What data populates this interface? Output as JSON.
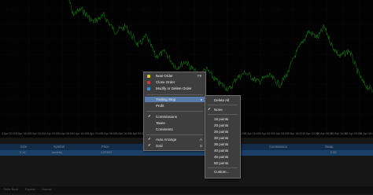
{
  "chart": {
    "x_labels": [
      "3 Apr 00:00",
      "3 Apr 08:00",
      "3 Apr 16:00",
      "4 Apr 00:00",
      "4 Apr 08:00",
      "4 Apr 16:00",
      "5 Apr 00:00",
      "5 Apr 08:00",
      "5 Apr 16:00",
      "6 Apr 00:00",
      "6 Apr 08:00",
      "6 Apr 16:00",
      "7 Apr 00:00",
      "7 Apr 08:00",
      "7 Apr 16:00",
      "8 Apr 00:00",
      "8 Apr 08:00",
      "8 Apr 16:00",
      "9 Apr 00:00",
      "9 Apr 08:00",
      "9 Apr 16:00",
      "10 Apr 00:00",
      "10 Apr 08:00",
      "10 Apr 16:00",
      "11 Apr 00:00",
      "11 Apr 08:00"
    ],
    "line_color": "#1fa51f"
  },
  "table": {
    "headers": {
      "size": "Size",
      "symbol": "Symbol",
      "price": "Price",
      "sl": "S/L",
      "tp": "T/P",
      "commission": "Commission",
      "swap": "Swap"
    },
    "row": {
      "size": "0.10",
      "symbol": "eurchfq",
      "price": "1.07453",
      "swap": "0.00"
    }
  },
  "tabs": [
    "Order Book",
    "Experts",
    "Journal"
  ],
  "context_menu": {
    "items": [
      {
        "label": "New Order",
        "shortcut": "F9",
        "icon_color": "#d8c23a"
      },
      {
        "label": "Close Order",
        "shortcut": "",
        "icon_color": "#c43a3a"
      },
      {
        "label": "Modify or Delete Order",
        "shortcut": "",
        "icon_color": "#3a8ad8"
      },
      {
        "label": "Trailing Stop",
        "shortcut": "",
        "submenu": true
      },
      {
        "label": "Profit",
        "shortcut": ""
      },
      {
        "label": "Commissions",
        "checked": true
      },
      {
        "label": "Taxes"
      },
      {
        "label": "Comments"
      },
      {
        "label": "Auto Arrange",
        "shortcut": "A",
        "checked": true
      },
      {
        "label": "Grid",
        "shortcut": "G",
        "checked": true
      }
    ]
  },
  "trailing_submenu": {
    "items": [
      {
        "label": "Delete All"
      },
      {
        "label": "None",
        "checked": true
      },
      {
        "label": "15 points"
      },
      {
        "label": "20 points"
      },
      {
        "label": "25 points"
      },
      {
        "label": "30 points"
      },
      {
        "label": "35 points"
      },
      {
        "label": "40 points"
      },
      {
        "label": "45 points"
      },
      {
        "label": "50 points"
      },
      {
        "label": "Custom..."
      }
    ]
  }
}
